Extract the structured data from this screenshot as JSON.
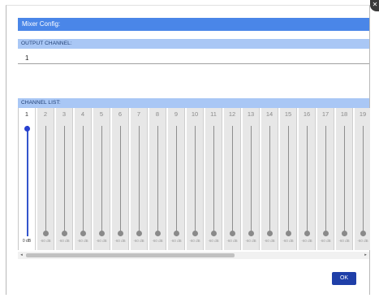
{
  "dialog": {
    "title": "Mixer Config:",
    "output_section_label": "OUTPUT CHANNEL:",
    "output_channel_value": "1",
    "channel_list_label": "CHANNEL LIST:",
    "ok_label": "OK"
  },
  "channels": [
    {
      "label": "1",
      "level": "0 dB",
      "fader_fraction": 1.0,
      "active": true
    },
    {
      "label": "2",
      "level": "-60 dB",
      "fader_fraction": 0.0,
      "active": false
    },
    {
      "label": "3",
      "level": "-60 dB",
      "fader_fraction": 0.0,
      "active": false
    },
    {
      "label": "4",
      "level": "-60 dB",
      "fader_fraction": 0.0,
      "active": false
    },
    {
      "label": "5",
      "level": "-60 dB",
      "fader_fraction": 0.0,
      "active": false
    },
    {
      "label": "6",
      "level": "-60 dB",
      "fader_fraction": 0.0,
      "active": false
    },
    {
      "label": "7",
      "level": "-60 dB",
      "fader_fraction": 0.0,
      "active": false
    },
    {
      "label": "8",
      "level": "-60 dB",
      "fader_fraction": 0.0,
      "active": false
    },
    {
      "label": "9",
      "level": "-60 dB",
      "fader_fraction": 0.0,
      "active": false
    },
    {
      "label": "10",
      "level": "-60 dB",
      "fader_fraction": 0.0,
      "active": false
    },
    {
      "label": "11",
      "level": "-60 dB",
      "fader_fraction": 0.0,
      "active": false
    },
    {
      "label": "12",
      "level": "-60 dB",
      "fader_fraction": 0.0,
      "active": false
    },
    {
      "label": "13",
      "level": "-60 dB",
      "fader_fraction": 0.0,
      "active": false
    },
    {
      "label": "14",
      "level": "-60 dB",
      "fader_fraction": 0.0,
      "active": false
    },
    {
      "label": "15",
      "level": "-60 dB",
      "fader_fraction": 0.0,
      "active": false
    },
    {
      "label": "16",
      "level": "-60 dB",
      "fader_fraction": 0.0,
      "active": false
    },
    {
      "label": "17",
      "level": "-60 dB",
      "fader_fraction": 0.0,
      "active": false
    },
    {
      "label": "18",
      "level": "-60 dB",
      "fader_fraction": 0.0,
      "active": false
    },
    {
      "label": "19",
      "level": "-60 dB",
      "fader_fraction": 0.0,
      "active": false
    }
  ],
  "scrollbar": {
    "left_arrow": "◂",
    "right_arrow": "▸",
    "thumb_fraction": 0.62
  },
  "colors": {
    "title_bar": "#4a86e8",
    "section_bar": "#a9c7f5",
    "active_fader": "#2840d0",
    "ok_button": "#1f3fa8"
  },
  "icons": {
    "close": "close-icon"
  }
}
